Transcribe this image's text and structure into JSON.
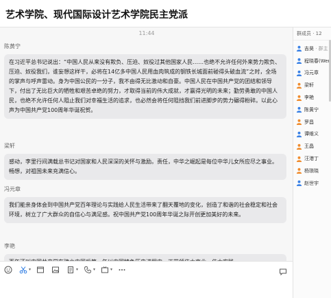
{
  "window": {
    "title": "艺术学院、现代国际设计艺术学院民主党派"
  },
  "chat": {
    "time": "11:44",
    "messages": [
      {
        "sender": "陈黄宁",
        "text": "在习近平总书记说出：“中国人民从来没有欺负、压迫、奴役过其他国家人民……也绝不允许任何外来势力欺负、压迫、奴役我们，谁妄想这样干，必将在14亿多中国人民用血肉筑成的钢铁长城面前碰得头破血流”之时，全场的掌声与呼声雷动。身为中国公民的一分子，我不由得无比激动和自豪。中国人民在中国共产党的团结和领导下，付出了无比巨大的牺牲和艰苦卓绝的努力，才取得当前的伟大成就，才赢得光明的未来；勤劳勇敢的中国人民，也绝不允许任何人阻止我们对幸福生活的追求，也必然会将任何阻挡我们前进脚步的势力碾得粉碎。以此心声为中国共产党100周年华诞祝贺。"
      },
      {
        "sender": "梁轩",
        "text": "感动，李里行间满载总书记对国家和人民深深的关怀与激励。责任，中华之崛起是每位中华儿女所应尽之事业。畅想，对祖国未来充满信心。"
      },
      {
        "sender": "冯元章",
        "text": "我们能亲身体会到中国共产党百年理论与实践给人民生活带来了翻天覆地的变化，创造了和谐的社会稳定和社会环境，树立了广大群众的自信心与满足感。祝中国共产党100周年华诞之际开创更加美好的未来。"
      },
      {
        "sender": "李艳",
        "text": "百年还叫中国共产党在建立中国后第一年以中国特色历史进程中，正带领伟大事业，伟大实践"
      }
    ]
  },
  "members": {
    "header": "群成员 · 12",
    "list": [
      {
        "name": "吉昊",
        "tag": " · 群主"
      },
      {
        "name": "程晓春(Wen",
        "tag": ""
      },
      {
        "name": "冯元章",
        "tag": ""
      },
      {
        "name": "梁轩",
        "tag": ""
      },
      {
        "name": "李艳",
        "tag": ""
      },
      {
        "name": "陈黄宁",
        "tag": ""
      },
      {
        "name": "罗昌",
        "tag": ""
      },
      {
        "name": "谭维义",
        "tag": ""
      },
      {
        "name": "王晶",
        "tag": ""
      },
      {
        "name": "汪港丁",
        "tag": ""
      },
      {
        "name": "杨琐晓",
        "tag": ""
      },
      {
        "name": "赵世宇",
        "tag": ""
      }
    ]
  },
  "toolbar": {
    "icons": [
      "emoji-icon",
      "scissors-icon",
      "folder-icon",
      "image-icon",
      "document-icon",
      "phone-icon",
      "live-icon",
      "more-icon",
      "chat-history-icon"
    ]
  },
  "colors": {
    "bubble": "#e9e9eb",
    "member_male": "#3b82e6",
    "member_female": "#f08c2e",
    "accent_blue": "#2a7ae2"
  }
}
